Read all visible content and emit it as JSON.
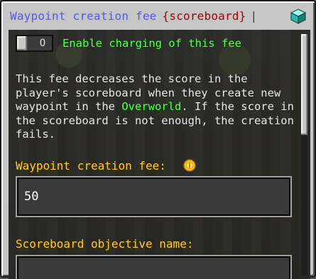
{
  "title": {
    "main": "Waypoint creation fee",
    "tag": "{scoreboard}",
    "separator": "|",
    "icon": "diamond-cube-icon"
  },
  "toggle": {
    "state_text": "O",
    "label": "Enable charging of this fee"
  },
  "description": {
    "part1": "This fee decreases the score in the player's scoreboard when they create new waypoint in the ",
    "highlight": "Overworld",
    "part2": ". If the score in the scoreboard is not enough, the creation fails."
  },
  "fee": {
    "label": "Waypoint creation fee:",
    "icon": "gold-coin-icon",
    "value": "50"
  },
  "objective": {
    "label": "Scoreboard objective name:",
    "value": ""
  },
  "colors": {
    "title": "#5555ff",
    "tag": "#aa0000",
    "enabled_green": "#55ff55",
    "label_gold": "#ffcc33"
  }
}
